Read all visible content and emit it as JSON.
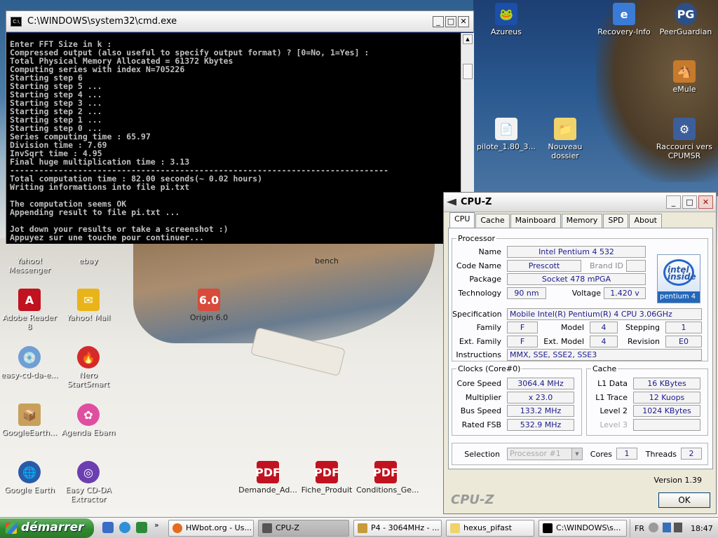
{
  "desktop": {
    "icons": [
      {
        "label": "Azureus"
      },
      {
        "label": "Recovery-Info"
      },
      {
        "label": "PeerGuardian"
      },
      {
        "label": "eMule"
      },
      {
        "label": "pilote_1.80_3..."
      },
      {
        "label": "Nouveau dossier"
      },
      {
        "label": "Raccourci vers CPUMSR"
      },
      {
        "label": "Yahoo! Messenger"
      },
      {
        "label": "ebay"
      },
      {
        "label": "bench"
      },
      {
        "label": "Adobe Reader 8"
      },
      {
        "label": "Yahoo! Mail"
      },
      {
        "label": "Origin 6.0"
      },
      {
        "label": "easy-cd-da-e..."
      },
      {
        "label": "Nero StartSmart"
      },
      {
        "label": "GoogleEarth..."
      },
      {
        "label": "Agenda Ebam"
      },
      {
        "label": "Google Earth"
      },
      {
        "label": "Easy CD-DA Extractor"
      },
      {
        "label": "Demande_Ad..."
      },
      {
        "label": "Fiche_Produit"
      },
      {
        "label": "Conditions_Ge..."
      }
    ]
  },
  "cmd": {
    "title": "C:\\WINDOWS\\system32\\cmd.exe",
    "lines": [
      "Enter FFT Size in k :",
      "Compressed output (also useful to specify output format) ? [0=No, 1=Yes] :",
      "Total Physical Memory Allocated = 61372 Kbytes",
      "Computing series with index N=705226",
      "Starting step 6",
      "Starting step 5 ...",
      "Starting step 4 ...",
      "Starting step 3 ...",
      "Starting step 2 ...",
      "Starting step 1 ...",
      "Starting step 0 ...",
      "Series computing time : 65.97",
      "Division time : 7.69",
      "InvSqrt time : 4.95",
      "Final huge multiplication time : 3.13",
      "------------------------------------------------------------------------------",
      "Total computation time : 82.00 seconds(~ 0.02 hours)",
      "Writing informations into file pi.txt",
      "",
      "The computation seems OK",
      "Appending result to file pi.txt ...",
      "",
      "Jot down your results or take a screenshot :)",
      "Appuyez sur une touche pour continuer..."
    ]
  },
  "cpuz": {
    "title": "CPU-Z",
    "tabs": [
      "CPU",
      "Cache",
      "Mainboard",
      "Memory",
      "SPD",
      "About"
    ],
    "processor_group": "Processor",
    "name_label": "Name",
    "name": "Intel Pentium 4 532",
    "codename_label": "Code Name",
    "codename": "Prescott",
    "brandid_label": "Brand ID",
    "package_label": "Package",
    "package": "Socket 478 mPGA",
    "technology_label": "Technology",
    "technology": "90 nm",
    "voltage_label": "Voltage",
    "voltage": "1.420 v",
    "spec_label": "Specification",
    "spec": "Mobile Intel(R) Pentium(R) 4 CPU 3.06GHz",
    "family_label": "Family",
    "family": "F",
    "model_label": "Model",
    "model": "4",
    "stepping_label": "Stepping",
    "stepping": "1",
    "extfamily_label": "Ext. Family",
    "extfamily": "F",
    "extmodel_label": "Ext. Model",
    "extmodel": "4",
    "revision_label": "Revision",
    "revision": "E0",
    "instr_label": "Instructions",
    "instr": "MMX, SSE, SSE2, SSE3",
    "logo_top": "intel inside",
    "logo_bottom": "pentium 4",
    "clocks_group": "Clocks (Core#0)",
    "corespeed_label": "Core Speed",
    "corespeed": "3064.4 MHz",
    "multiplier_label": "Multiplier",
    "multiplier": "x 23.0",
    "busspeed_label": "Bus Speed",
    "busspeed": "133.2 MHz",
    "ratedfsb_label": "Rated FSB",
    "ratedfsb": "532.9 MHz",
    "cache_group": "Cache",
    "l1data_label": "L1 Data",
    "l1data": "16 KBytes",
    "l1trace_label": "L1 Trace",
    "l1trace": "12 Kuops",
    "level2_label": "Level 2",
    "level2": "1024 KBytes",
    "level3_label": "Level 3",
    "level3": "",
    "selection_label": "Selection",
    "selection": "Processor #1",
    "cores_label": "Cores",
    "cores": "1",
    "threads_label": "Threads",
    "threads": "2",
    "version": "Version 1.39",
    "brand": "CPU-Z",
    "ok": "OK"
  },
  "taskbar": {
    "start": "démarrer",
    "tasks": [
      {
        "label": "HWbot.org - Us..."
      },
      {
        "label": "CPU-Z"
      },
      {
        "label": "P4 - 3064MHz - ..."
      },
      {
        "label": "hexus_pifast"
      },
      {
        "label": "C:\\WINDOWS\\s..."
      }
    ],
    "lang": "FR",
    "clock": "18:47"
  }
}
